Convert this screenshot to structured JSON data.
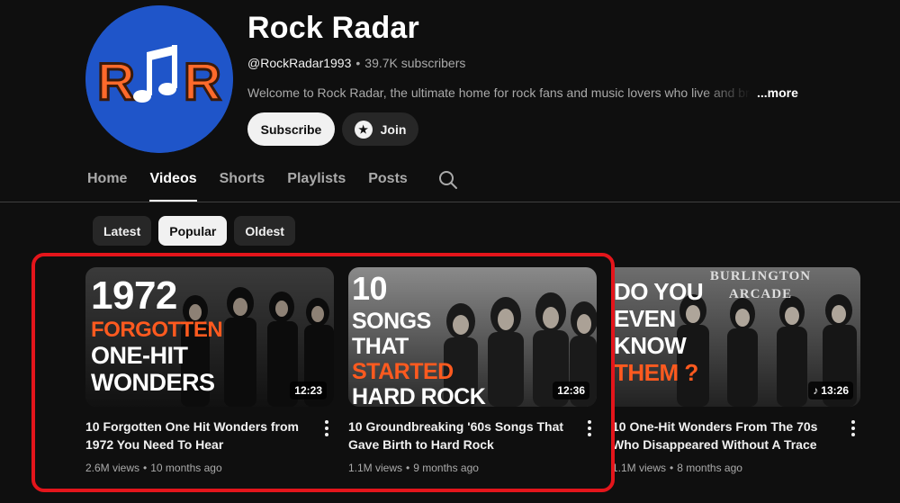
{
  "channel": {
    "title": "Rock Radar",
    "handle": "@RockRadar1993",
    "subscribers": "39.7K subscribers",
    "description": "Welcome to Rock Radar, the ultimate home for rock fans and music lovers who live and breathe",
    "more_label": "...more",
    "avatar_text_left": "R",
    "avatar_text_right": "R",
    "avatar_icon": "music-note-icon",
    "subscribe_label": "Subscribe",
    "join_label": "Join"
  },
  "tabs": [
    {
      "label": "Home"
    },
    {
      "label": "Videos"
    },
    {
      "label": "Shorts"
    },
    {
      "label": "Playlists"
    },
    {
      "label": "Posts"
    }
  ],
  "active_tab": "Videos",
  "chips": [
    {
      "label": "Latest"
    },
    {
      "label": "Popular"
    },
    {
      "label": "Oldest"
    }
  ],
  "selected_chip": "Popular",
  "videos": [
    {
      "title": "10 Forgotten One Hit Wonders from 1972 You Need To Hear",
      "views": "2.6M views",
      "age": "10 months ago",
      "duration": "12:23",
      "thumb_lines": [
        "1972",
        "FORGOTTEN",
        "ONE-HIT",
        "WONDERS"
      ]
    },
    {
      "title": "10 Groundbreaking '60s Songs That Gave Birth to Hard Rock",
      "views": "1.1M views",
      "age": "9 months ago",
      "duration": "12:36",
      "thumb_lines": [
        "10",
        "SONGS",
        "THAT",
        "STARTED",
        "HARD ROCK"
      ]
    },
    {
      "title": "10 One-Hit Wonders From The 70s Who Disappeared Without A Trace",
      "views": "1.1M views",
      "age": "8 months ago",
      "duration": "13:26",
      "thumb_lines": [
        "DO YOU",
        "EVEN",
        "KNOW",
        "THEM ?"
      ],
      "thumb_sign": "BURLINGTON ARCADE"
    }
  ],
  "colors": {
    "background": "#0f0f0f",
    "avatar_blue": "#1f55c9",
    "avatar_letters": "#ff6a2b",
    "thumb_accent": "#ff5a1f",
    "highlight_red": "#e4151b"
  }
}
